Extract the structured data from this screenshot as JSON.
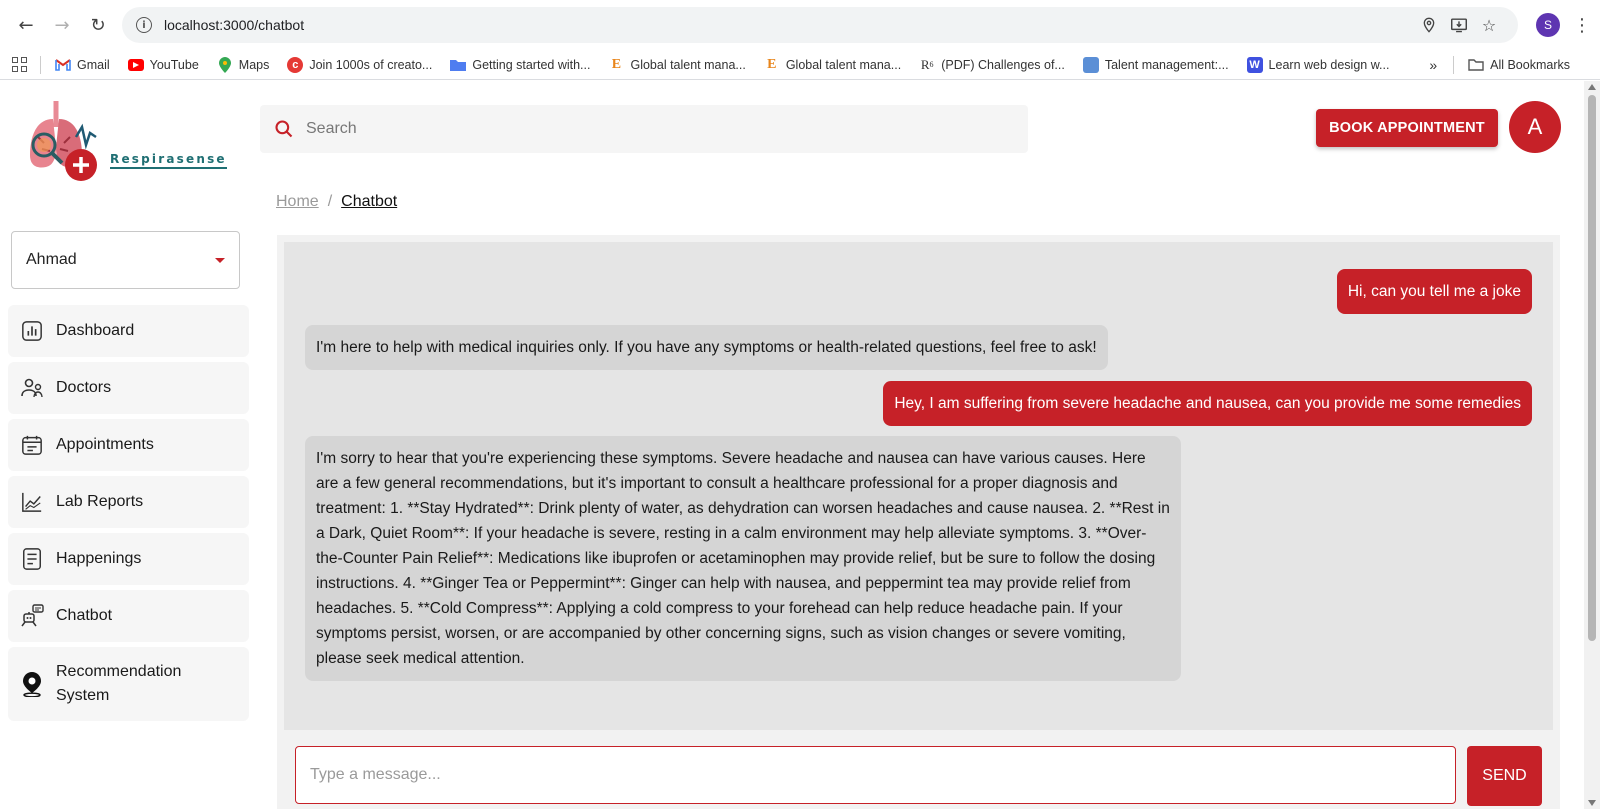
{
  "browser": {
    "url": "localhost:3000/chatbot",
    "profile_initial": "S",
    "bookmarks": [
      {
        "label": "Gmail",
        "icon": "gmail-icon"
      },
      {
        "label": "YouTube",
        "icon": "youtube-icon"
      },
      {
        "label": "Maps",
        "icon": "maps-icon"
      },
      {
        "label": "Join 1000s of creato...",
        "icon": "creator-icon"
      },
      {
        "label": "Getting started with...",
        "icon": "folder-blue-icon"
      },
      {
        "label": "Global talent mana...",
        "icon": "e-icon"
      },
      {
        "label": "Global talent mana...",
        "icon": "e-icon"
      },
      {
        "label": "(PDF) Challenges of...",
        "icon": "researchgate-icon"
      },
      {
        "label": "Talent management:...",
        "icon": "image-icon"
      },
      {
        "label": "Learn web design w...",
        "icon": "w-icon"
      }
    ],
    "more_label": "»",
    "all_bookmarks": "All Bookmarks"
  },
  "app": {
    "logo_text": "Respirasense",
    "search_placeholder": "Search",
    "book_button": "BOOK APPOINTMENT",
    "avatar_initial": "A",
    "user_select": "Ahmad",
    "sidebar": [
      {
        "label": "Dashboard",
        "icon": "dashboard-icon"
      },
      {
        "label": "Doctors",
        "icon": "doctors-icon"
      },
      {
        "label": "Appointments",
        "icon": "appointments-icon"
      },
      {
        "label": "Lab Reports",
        "icon": "lab-reports-icon"
      },
      {
        "label": "Happenings",
        "icon": "happenings-icon"
      },
      {
        "label": "Chatbot",
        "icon": "chatbot-icon"
      },
      {
        "label": "Recommendation System",
        "icon": "location-pin-icon"
      }
    ],
    "breadcrumb": {
      "home": "Home",
      "sep": "/",
      "current": "Chatbot"
    },
    "messages": [
      {
        "role": "user",
        "text": "Hi, can you tell me a joke"
      },
      {
        "role": "bot",
        "text": "I'm here to help with medical inquiries only. If you have any symptoms or health-related questions, feel free to ask!"
      },
      {
        "role": "user",
        "text": "Hey, I am suffering from severe headache and nausea, can you provide me some remedies"
      },
      {
        "role": "bot",
        "text": "I'm sorry to hear that you're experiencing these symptoms. Severe headache and nausea can have various causes. Here are a few general recommendations, but it's important to consult a healthcare professional for a proper diagnosis and treatment: 1. **Stay Hydrated**: Drink plenty of water, as dehydration can worsen headaches and cause nausea. 2. **Rest in a Dark, Quiet Room**: If your headache is severe, resting in a calm environment may help alleviate symptoms. 3. **Over-the-Counter Pain Relief**: Medications like ibuprofen or acetaminophen may provide relief, but be sure to follow the dosing instructions. 4. **Ginger Tea or Peppermint**: Ginger can help with nausea, and peppermint tea may provide relief from headaches. 5. **Cold Compress**: Applying a cold compress to your forehead can help reduce headache pain. If your symptoms persist, worsen, or are accompanied by other concerning signs, such as vision changes or severe vomiting, please seek medical attention."
      }
    ],
    "input_placeholder": "Type a message...",
    "send_button": "SEND",
    "colors": {
      "accent": "#c62128",
      "bot_bubble": "#d5d5d5",
      "chat_bg": "#e5e5e5"
    }
  }
}
